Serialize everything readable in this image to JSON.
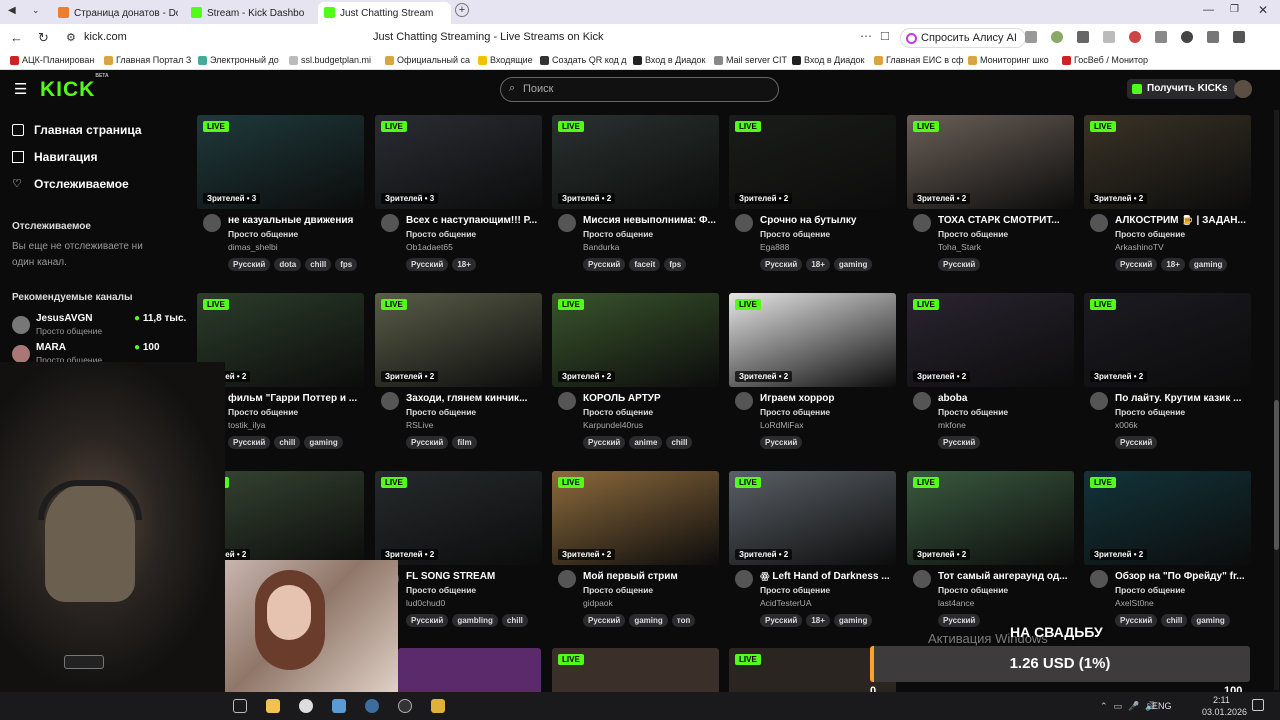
{
  "browser": {
    "tabs": [
      {
        "title": "Страница донатов - Dona",
        "color": "#f07d2a"
      },
      {
        "title": "Stream - Kick Dashbo",
        "color": "#53fc18"
      },
      {
        "title": "Just Chatting Stream",
        "color": "#53fc18"
      }
    ],
    "url": "kick.com",
    "page_title": "Just Chatting Streaming - Live Streams on Kick",
    "alice": "Спросить Алису AI",
    "bookmarks": [
      "АЦК-Планирован",
      "Главная Портал З",
      "Электронный до",
      "ssl.budgetplan.mi",
      "Официальный са",
      "Входящие",
      "Создать QR код д",
      "Вход в Диадок",
      "Mail server CIT",
      "Вход в Диадок",
      "Главная ЕИС в сф",
      "Мониторинг шко",
      "ГосВеб / Монитор"
    ]
  },
  "site": {
    "logo": "KICK",
    "logo_beta": "BETA",
    "search_placeholder": "Поиск",
    "get_kicks": "Получить KICKs",
    "nav": [
      "Главная страница",
      "Навигация",
      "Отслеживаемое"
    ],
    "followed_title": "Отслеживаемое",
    "followed_empty": "Вы еще не отслеживаете ни один канал.",
    "recommended_title": "Рекомендуемые каналы",
    "recommended": [
      {
        "name": "JesusAVGN",
        "cat": "Просто общение",
        "viewers": "11,8 тыс."
      },
      {
        "name": "MARA",
        "cat": "Просто общение",
        "viewers": "100"
      }
    ]
  },
  "streams": [
    {
      "title": "не казуальные движения",
      "cat": "Просто общение",
      "user": "dimas_shelbi",
      "viewers": "Зрителей • 3",
      "tags": [
        "Русский",
        "dota",
        "chill",
        "fps"
      ],
      "thumb": "#1f3a3c"
    },
    {
      "title": "Всех с наступающим!!! Р...",
      "cat": "Просто общение",
      "user": "Ob1adaet65",
      "viewers": "Зрителей • 3",
      "tags": [
        "Русский",
        "18+"
      ],
      "thumb": "#2a2d33"
    },
    {
      "title": "Миссия невыполнима: Ф...",
      "cat": "Просто общение",
      "user": "Bandurka",
      "viewers": "Зрителей • 2",
      "tags": [
        "Русский",
        "faceit",
        "fps"
      ],
      "thumb": "#2a3230"
    },
    {
      "title": "Срочно на бутылку",
      "cat": "Просто общение",
      "user": "Ega888",
      "viewers": "Зрителей • 2",
      "tags": [
        "Русский",
        "18+",
        "gaming"
      ],
      "thumb": "#1b1d1a"
    },
    {
      "title": "ТОХА СТАРК СМОТРИТ...",
      "cat": "Просто общение",
      "user": "Toha_Stark",
      "viewers": "Зрителей • 2",
      "tags": [
        "Русский"
      ],
      "thumb": "#6a5f57"
    },
    {
      "title": "АЛКОСТРИМ 🍺 | ЗАДАН...",
      "cat": "Просто общение",
      "user": "ArkashinoTV",
      "viewers": "Зрителей • 2",
      "tags": [
        "Русский",
        "18+",
        "gaming"
      ],
      "thumb": "#3a3326"
    },
    {
      "title": "фильм \"Гарри Поттер и ...",
      "cat": "Просто общение",
      "user": "tostik_ilya",
      "viewers": "ителей • 2",
      "tags": [
        "Русский",
        "chill",
        "gaming"
      ],
      "thumb": "#2b3d2a"
    },
    {
      "title": "Заходи, глянем кинчик...",
      "cat": "Просто общение",
      "user": "RSLive",
      "viewers": "Зрителей • 2",
      "tags": [
        "Русский",
        "film"
      ],
      "thumb": "#5a5d48"
    },
    {
      "title": "КОРОЛЬ АРТУР",
      "cat": "Просто общение",
      "user": "Karpundel40rus",
      "viewers": "Зрителей • 2",
      "tags": [
        "Русский",
        "anime",
        "chill"
      ],
      "thumb": "#39552c"
    },
    {
      "title": "Играем хоррор",
      "cat": "Просто общение",
      "user": "LoRdMiFax",
      "viewers": "Зрителей • 2",
      "tags": [
        "Русский"
      ],
      "thumb": "#e6e6e6"
    },
    {
      "title": "aboba",
      "cat": "Просто общение",
      "user": "mkfone",
      "viewers": "Зрителей • 2",
      "tags": [
        "Русский"
      ],
      "thumb": "#2a2430"
    },
    {
      "title": "По лайту. Крутим казик ...",
      "cat": "Просто общение",
      "user": "x006k",
      "viewers": "Зрителей • 2",
      "tags": [
        "Русский"
      ],
      "thumb": "#1b1b22"
    },
    {
      "title": "",
      "cat": "",
      "user": "",
      "viewers": "ителей • 2",
      "tags": [],
      "thumb": "#364532"
    },
    {
      "title": "FL SONG STREAM",
      "cat": "Просто общение",
      "user": "lud0chud0",
      "viewers": "Зрителей • 2",
      "tags": [
        "Русский",
        "gambling",
        "chill"
      ],
      "thumb": "#262a2c"
    },
    {
      "title": "Мой первый стрим",
      "cat": "Просто общение",
      "user": "gidpaok",
      "viewers": "Зрителей • 2",
      "tags": [
        "Русский",
        "gaming",
        "топ"
      ],
      "thumb": "#8c6a3c"
    },
    {
      "title": "ꙮ Left Hand of Darkness ...",
      "cat": "Просто общение",
      "user": "AcidTesterUA",
      "viewers": "Зрителей • 2",
      "tags": [
        "Русский",
        "18+",
        "gaming"
      ],
      "thumb": "#5a6066"
    },
    {
      "title": "Тот самый ангерaунд од...",
      "cat": "Просто общение",
      "user": "last4ance",
      "viewers": "Зрителей • 2",
      "tags": [
        "Русский"
      ],
      "thumb": "#3a5a3f"
    },
    {
      "title": "Обзор на \"По Фрейду\" fr...",
      "cat": "Просто общение",
      "user": "AxelSt0ne",
      "viewers": "Зрителей • 2",
      "tags": [
        "Русский",
        "chill",
        "gaming"
      ],
      "thumb": "#12343a"
    }
  ],
  "overlay": {
    "donation_goal": "НА СВАДЬБУ",
    "amount": "1.26 USD (1%)",
    "progress_fraction": 0.01,
    "min": "0",
    "max": "100",
    "windows_activation": "Активация Windows"
  },
  "taskbar": {
    "lang": "ENG",
    "time": "2:11",
    "date": "03.01.2026"
  }
}
